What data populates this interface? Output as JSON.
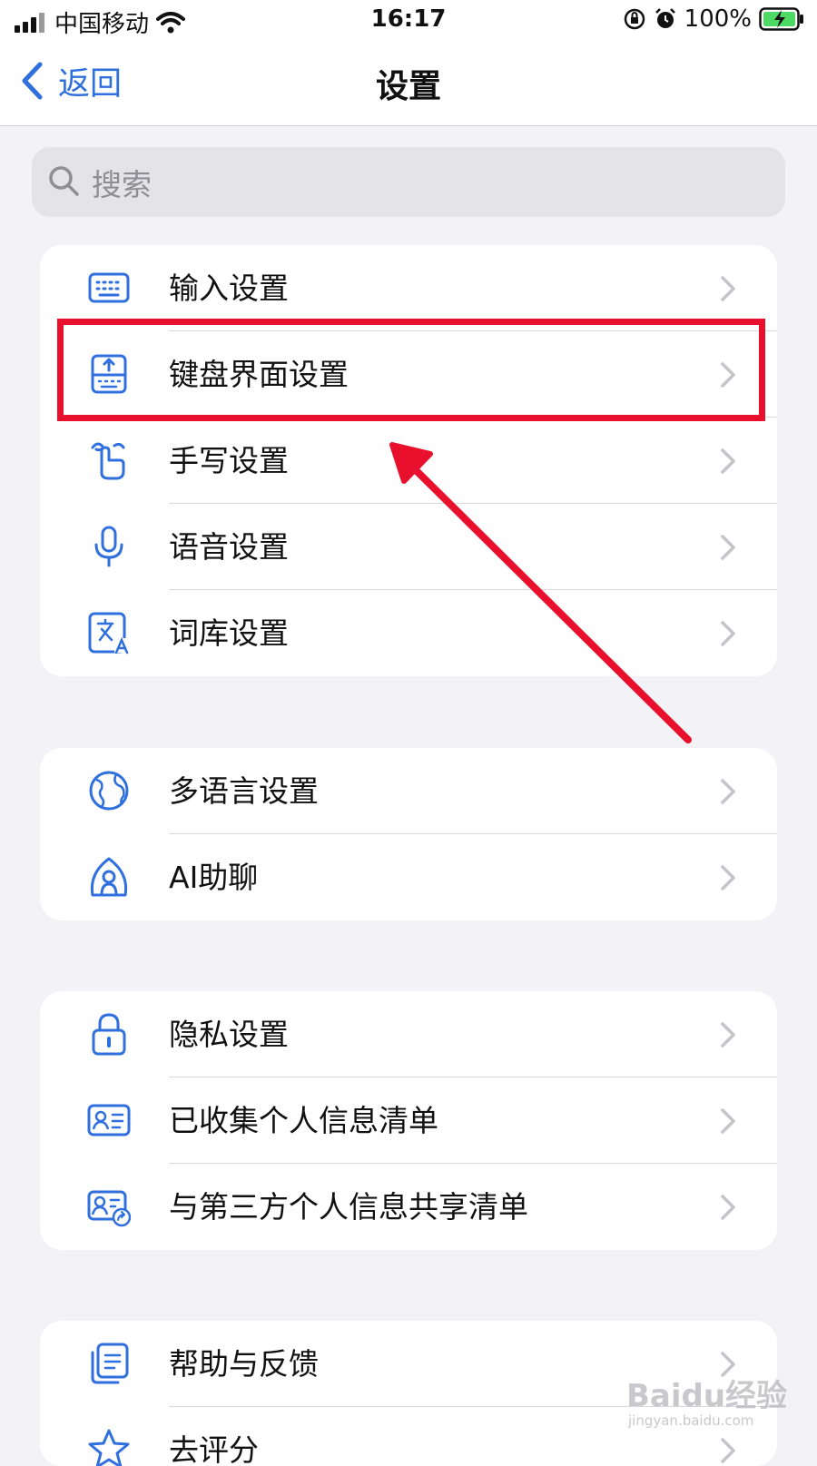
{
  "status_bar": {
    "carrier": "中国移动",
    "time": "16:17",
    "battery": "100%",
    "icons": [
      "signal-icon",
      "wifi-icon",
      "orientation-lock-icon",
      "alarm-icon",
      "battery-charging-icon"
    ]
  },
  "nav": {
    "back_label": "返回",
    "title": "设置",
    "back_icon": "chevron-left-icon"
  },
  "search": {
    "placeholder": "搜索",
    "icon": "search-icon"
  },
  "groups": [
    {
      "items": [
        {
          "label": "输入设置",
          "icon": "keyboard-icon"
        },
        {
          "label": "键盘界面设置",
          "icon": "keyboard-layout-icon"
        },
        {
          "label": "手写设置",
          "icon": "handwriting-icon"
        },
        {
          "label": "语音设置",
          "icon": "microphone-icon"
        },
        {
          "label": "词库设置",
          "icon": "dictionary-icon"
        }
      ]
    },
    {
      "items": [
        {
          "label": "多语言设置",
          "icon": "globe-icon"
        },
        {
          "label": "AI助聊",
          "icon": "ai-assistant-icon"
        }
      ]
    },
    {
      "items": [
        {
          "label": "隐私设置",
          "icon": "lock-icon"
        },
        {
          "label": "已收集个人信息清单",
          "icon": "id-card-icon"
        },
        {
          "label": "与第三方个人信息共享清单",
          "icon": "share-card-icon"
        }
      ]
    },
    {
      "items": [
        {
          "label": "帮助与反馈",
          "icon": "help-feedback-icon"
        },
        {
          "label": "去评分",
          "icon": "star-icon"
        }
      ]
    }
  ],
  "annotation": {
    "highlight_color": "#e8102c",
    "highlighted_item": "键盘界面设置"
  },
  "watermark": {
    "main": "Baidu经验",
    "sub": "jingyan.baidu.com"
  },
  "colors": {
    "accent": "#2f6fde",
    "background": "#f2f2f7",
    "annotation": "#e8102c"
  }
}
